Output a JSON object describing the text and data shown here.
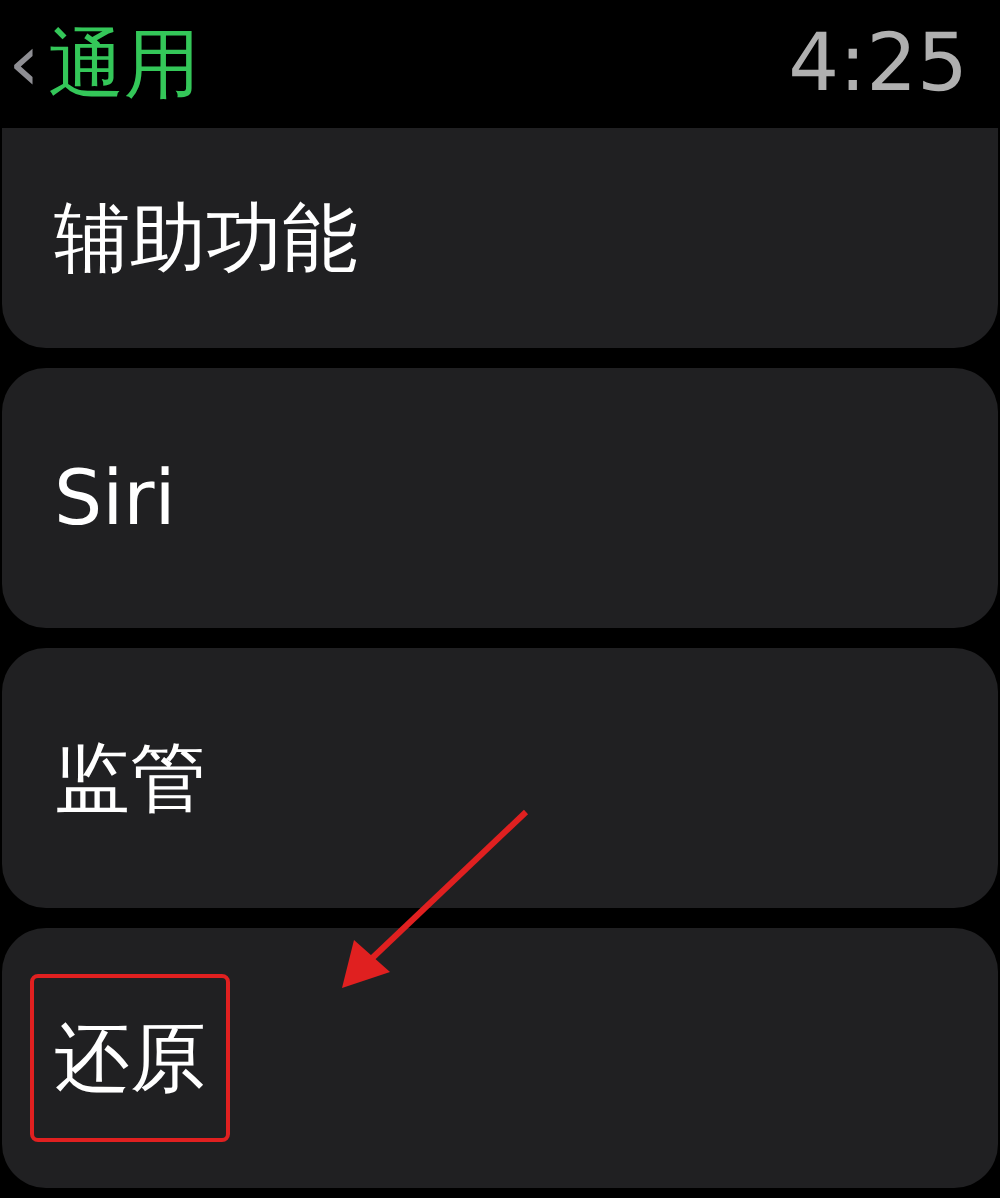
{
  "header": {
    "back": "‹",
    "title": "通用",
    "time": "4:25"
  },
  "items": [
    {
      "label": "辅助功能",
      "highlighted": false
    },
    {
      "label": "Siri",
      "highlighted": false
    },
    {
      "label": "监管",
      "highlighted": false
    },
    {
      "label": "还原",
      "highlighted": true
    }
  ]
}
